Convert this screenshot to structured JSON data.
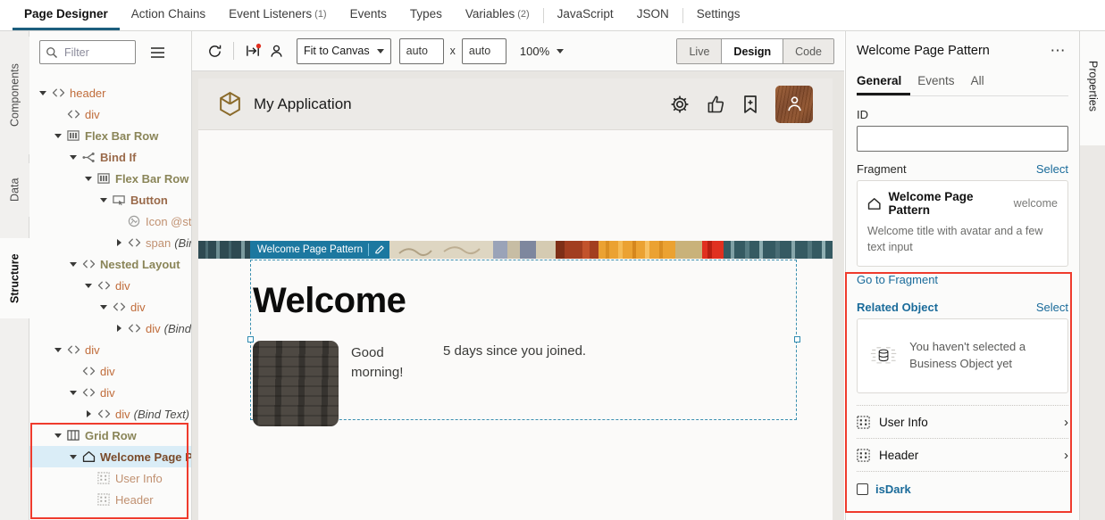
{
  "top_tabs": [
    {
      "label": "Page Designer",
      "count": "",
      "active": true,
      "sep_after": false
    },
    {
      "label": "Action Chains",
      "count": "",
      "active": false,
      "sep_after": false
    },
    {
      "label": "Event Listeners",
      "count": "(1)",
      "active": false,
      "sep_after": false
    },
    {
      "label": "Events",
      "count": "",
      "active": false,
      "sep_after": false
    },
    {
      "label": "Types",
      "count": "",
      "active": false,
      "sep_after": false
    },
    {
      "label": "Variables",
      "count": "(2)",
      "active": false,
      "sep_after": true
    },
    {
      "label": "JavaScript",
      "count": "",
      "active": false,
      "sep_after": false
    },
    {
      "label": "JSON",
      "count": "",
      "active": false,
      "sep_after": true
    },
    {
      "label": "Settings",
      "count": "",
      "active": false,
      "sep_after": false
    }
  ],
  "left_rail": {
    "tabs": [
      {
        "label": "Components",
        "active": false
      },
      {
        "label": "Data",
        "active": false
      },
      {
        "label": "Structure",
        "active": true
      }
    ]
  },
  "structure": {
    "filter": {
      "placeholder": "Filter",
      "value": ""
    },
    "menu_icon": "hamburger-icon",
    "tree": [
      {
        "indent": 0,
        "twisty": "down",
        "icon": "code-tag-icon",
        "label": "header",
        "style": "tag",
        "italic": "",
        "selected": false
      },
      {
        "indent": 1,
        "twisty": "none",
        "icon": "code-tag-icon",
        "label": "div",
        "style": "tag",
        "italic": "",
        "selected": false
      },
      {
        "indent": 1,
        "twisty": "down",
        "icon": "flex-bar-icon",
        "label": "Flex Bar Row",
        "style": "cmp",
        "italic": "",
        "selected": false
      },
      {
        "indent": 2,
        "twisty": "down",
        "icon": "bind-if-icon",
        "label": "Bind If",
        "style": "brn",
        "italic": "",
        "selected": false
      },
      {
        "indent": 3,
        "twisty": "down",
        "icon": "flex-bar-icon",
        "label": "Flex Bar Row",
        "style": "cmp",
        "italic": "",
        "selected": false
      },
      {
        "indent": 4,
        "twisty": "down",
        "icon": "button-icon",
        "label": "Button",
        "style": "brn",
        "italic": "",
        "selected": false
      },
      {
        "indent": 5,
        "twisty": "none",
        "icon": "icon-slot-icon",
        "label": "Icon @start",
        "style": "dim",
        "italic": "",
        "selected": false
      },
      {
        "indent": 5,
        "twisty": "right",
        "icon": "code-tag-icon",
        "label": "span",
        "style": "dim",
        "italic": "(Bind",
        "selected": false
      },
      {
        "indent": 2,
        "twisty": "down",
        "icon": "code-tag-icon",
        "label": "Nested Layout",
        "style": "cmp",
        "italic": "",
        "selected": false
      },
      {
        "indent": 3,
        "twisty": "down",
        "icon": "code-tag-icon",
        "label": "div",
        "style": "tag",
        "italic": "",
        "selected": false
      },
      {
        "indent": 4,
        "twisty": "down",
        "icon": "code-tag-icon",
        "label": "div",
        "style": "tag",
        "italic": "",
        "selected": false
      },
      {
        "indent": 5,
        "twisty": "right",
        "icon": "code-tag-icon",
        "label": "div",
        "style": "tag",
        "italic": "(Bind T",
        "selected": false
      },
      {
        "indent": 1,
        "twisty": "down",
        "icon": "code-tag-icon",
        "label": "div",
        "style": "tag",
        "italic": "",
        "selected": false
      },
      {
        "indent": 2,
        "twisty": "none",
        "icon": "code-tag-icon",
        "label": "div",
        "style": "tag",
        "italic": "",
        "selected": false
      },
      {
        "indent": 2,
        "twisty": "down",
        "icon": "code-tag-icon",
        "label": "div",
        "style": "tag",
        "italic": "",
        "selected": false
      },
      {
        "indent": 3,
        "twisty": "right",
        "icon": "code-tag-icon",
        "label": "div",
        "style": "tag",
        "italic": "(Bind Text)",
        "selected": false
      },
      {
        "indent": 1,
        "twisty": "down",
        "icon": "grid-row-icon",
        "label": "Grid Row",
        "style": "cmp",
        "italic": "",
        "selected": false
      },
      {
        "indent": 2,
        "twisty": "down",
        "icon": "fragment-icon",
        "label": "Welcome Page Patt",
        "style": "pat",
        "italic": "",
        "selected": true
      },
      {
        "indent": 3,
        "twisty": "none",
        "icon": "slot-icon",
        "label": "User Info",
        "style": "dim",
        "italic": "",
        "selected": false
      },
      {
        "indent": 3,
        "twisty": "none",
        "icon": "slot-icon",
        "label": "Header",
        "style": "dim",
        "italic": "",
        "selected": false
      }
    ]
  },
  "canvas_toolbar": {
    "refresh_icon": "refresh-icon",
    "responsive_icon": "responsive-preview-icon",
    "user_icon": "user-icon",
    "size_select": "Fit to Canvas",
    "width_value": "auto",
    "height_value": "auto",
    "dimension_x": "x",
    "zoom_value": "100%",
    "modes": [
      {
        "label": "Live",
        "active": false
      },
      {
        "label": "Design",
        "active": true
      },
      {
        "label": "Code",
        "active": false
      }
    ]
  },
  "canvas": {
    "app_header": {
      "logo_icon": "cube-logo-icon",
      "title": "My Application",
      "icons": [
        "gear-icon",
        "thumbs-up-icon",
        "bookmark-plus-icon",
        "user-avatar-button"
      ]
    },
    "selection_badge": {
      "label": "Welcome Page Pattern",
      "edit_icon": "pencil-icon"
    },
    "welcome": {
      "title": "Welcome",
      "greeting": "Good morning!",
      "days_message": "5 days since you joined.",
      "avatar_icon": "avatar-image"
    }
  },
  "properties": {
    "rail_label": "Properties",
    "title": "Welcome Page Pattern",
    "overflow_icon": "more-options-icon",
    "tabs": [
      {
        "label": "General",
        "active": true
      },
      {
        "label": "Events",
        "active": false
      },
      {
        "label": "All",
        "active": false
      }
    ],
    "id": {
      "label": "ID",
      "value": "",
      "placeholder": ""
    },
    "fragment": {
      "label": "Fragment",
      "select_link": "Select",
      "card_icon": "fragment-home-icon",
      "card_name": "Welcome Page Pattern",
      "card_tag": "welcome",
      "card_desc": "Welcome title with avatar and a few text input",
      "go_link": "Go to Fragment"
    },
    "related_object": {
      "label": "Related Object",
      "select_link": "Select",
      "empty_icon": "database-empty-icon",
      "empty_text": "You haven't selected a Business Object yet"
    },
    "slots": [
      {
        "label": "User Info",
        "icon": "slot-grid-icon",
        "chevron": "›"
      },
      {
        "label": "Header",
        "icon": "slot-grid-icon",
        "chevron": "›"
      }
    ],
    "checkbox": {
      "label": "isDark",
      "checked": false,
      "icon": "checkbox-icon"
    }
  },
  "colors": {
    "accent_teal": "#1c78a0",
    "highlight_red": "#ef3b2d",
    "link_blue": "#1a6b9a",
    "selected_row": "#daedf7",
    "avatar_brown": "#7d4526"
  }
}
